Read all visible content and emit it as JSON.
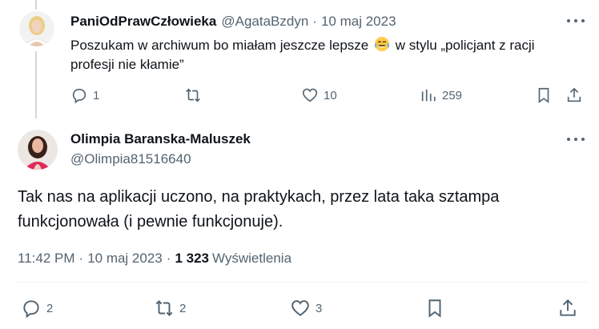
{
  "parent_tweet": {
    "display_name": "PaniOdPrawCzłowieka",
    "handle": "@AgataBzdyn",
    "separator": "·",
    "date": "10 maj 2023",
    "text_before_emoji": "Poszukam w archiwum bo miałam jeszcze lepsze",
    "emoji": "face-with-tears-of-joy-emoji",
    "text_after_emoji": "w stylu „policjant z racji profesji nie kłamie”",
    "actions": {
      "reply_count": "1",
      "repost_count": "",
      "like_count": "10",
      "views_count": "259"
    }
  },
  "main_tweet": {
    "display_name": "Olimpia Baranska-Maluszek",
    "handle": "@Olimpia81516640",
    "text": "Tak nas na aplikacji uczono, na praktykach, przez lata taka sztampa funkcjonowała (i pewnie funkcjonuje).",
    "time": "11:42 PM",
    "separator": "·",
    "date": "10 maj 2023",
    "views_count": "1 323",
    "views_label": "Wyświetlenia",
    "actions": {
      "reply_count": "2",
      "repost_count": "2",
      "like_count": "3"
    }
  },
  "colors": {
    "text_primary": "#0f1419",
    "text_secondary": "#536471",
    "divider": "#eff3f4",
    "thread_line": "#cfd9de"
  }
}
